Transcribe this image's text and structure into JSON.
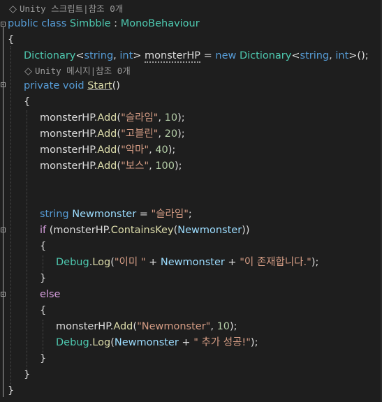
{
  "hints": {
    "class_refs": "Unity 스크립트|참조 0개",
    "method_refs": "Unity 메시지|참조 0개"
  },
  "tokens": {
    "public": "public",
    "class": "class",
    "class_name": "Simbble",
    "colon": " : ",
    "base": "MonoBehaviour",
    "open_brace": "{",
    "close_brace": "}",
    "dictionary": "Dictionary",
    "lt": "<",
    "string": "string",
    "comma": ", ",
    "int": "int",
    "gt": ">",
    "space": " ",
    "field_name": "monsterHP",
    "assign": " = ",
    "new": "new",
    "ctor_end": ">();",
    "private": "private",
    "void": "void",
    "start": "Start",
    "parens": "()",
    "monsterHP": "monsterHP",
    "dot": ".",
    "add": "Add",
    "lparen": "(",
    "str_slime": "\"슬라임\"",
    "num_10": "10",
    "str_goblin": "\"고블린\"",
    "num_20": "20",
    "str_demon": "\"악마\"",
    "num_40": "40",
    "str_boss": "\"보스\"",
    "num_100": "100",
    "rparen_semi": ");",
    "var_name": "Newmonster",
    "semi": ";",
    "if": "if",
    "space_lparen": " (",
    "contains_key": "ContainsKey",
    "rparen2": "))",
    "debug": "Debug",
    "log": "Log",
    "str_already": "\"이미 \"",
    "plus": " + ",
    "str_exists": "\"이 존재합니다.\"",
    "else": "else",
    "str_newmonster": "\"Newmonster\"",
    "str_success": "\" 추가 성공!\""
  }
}
